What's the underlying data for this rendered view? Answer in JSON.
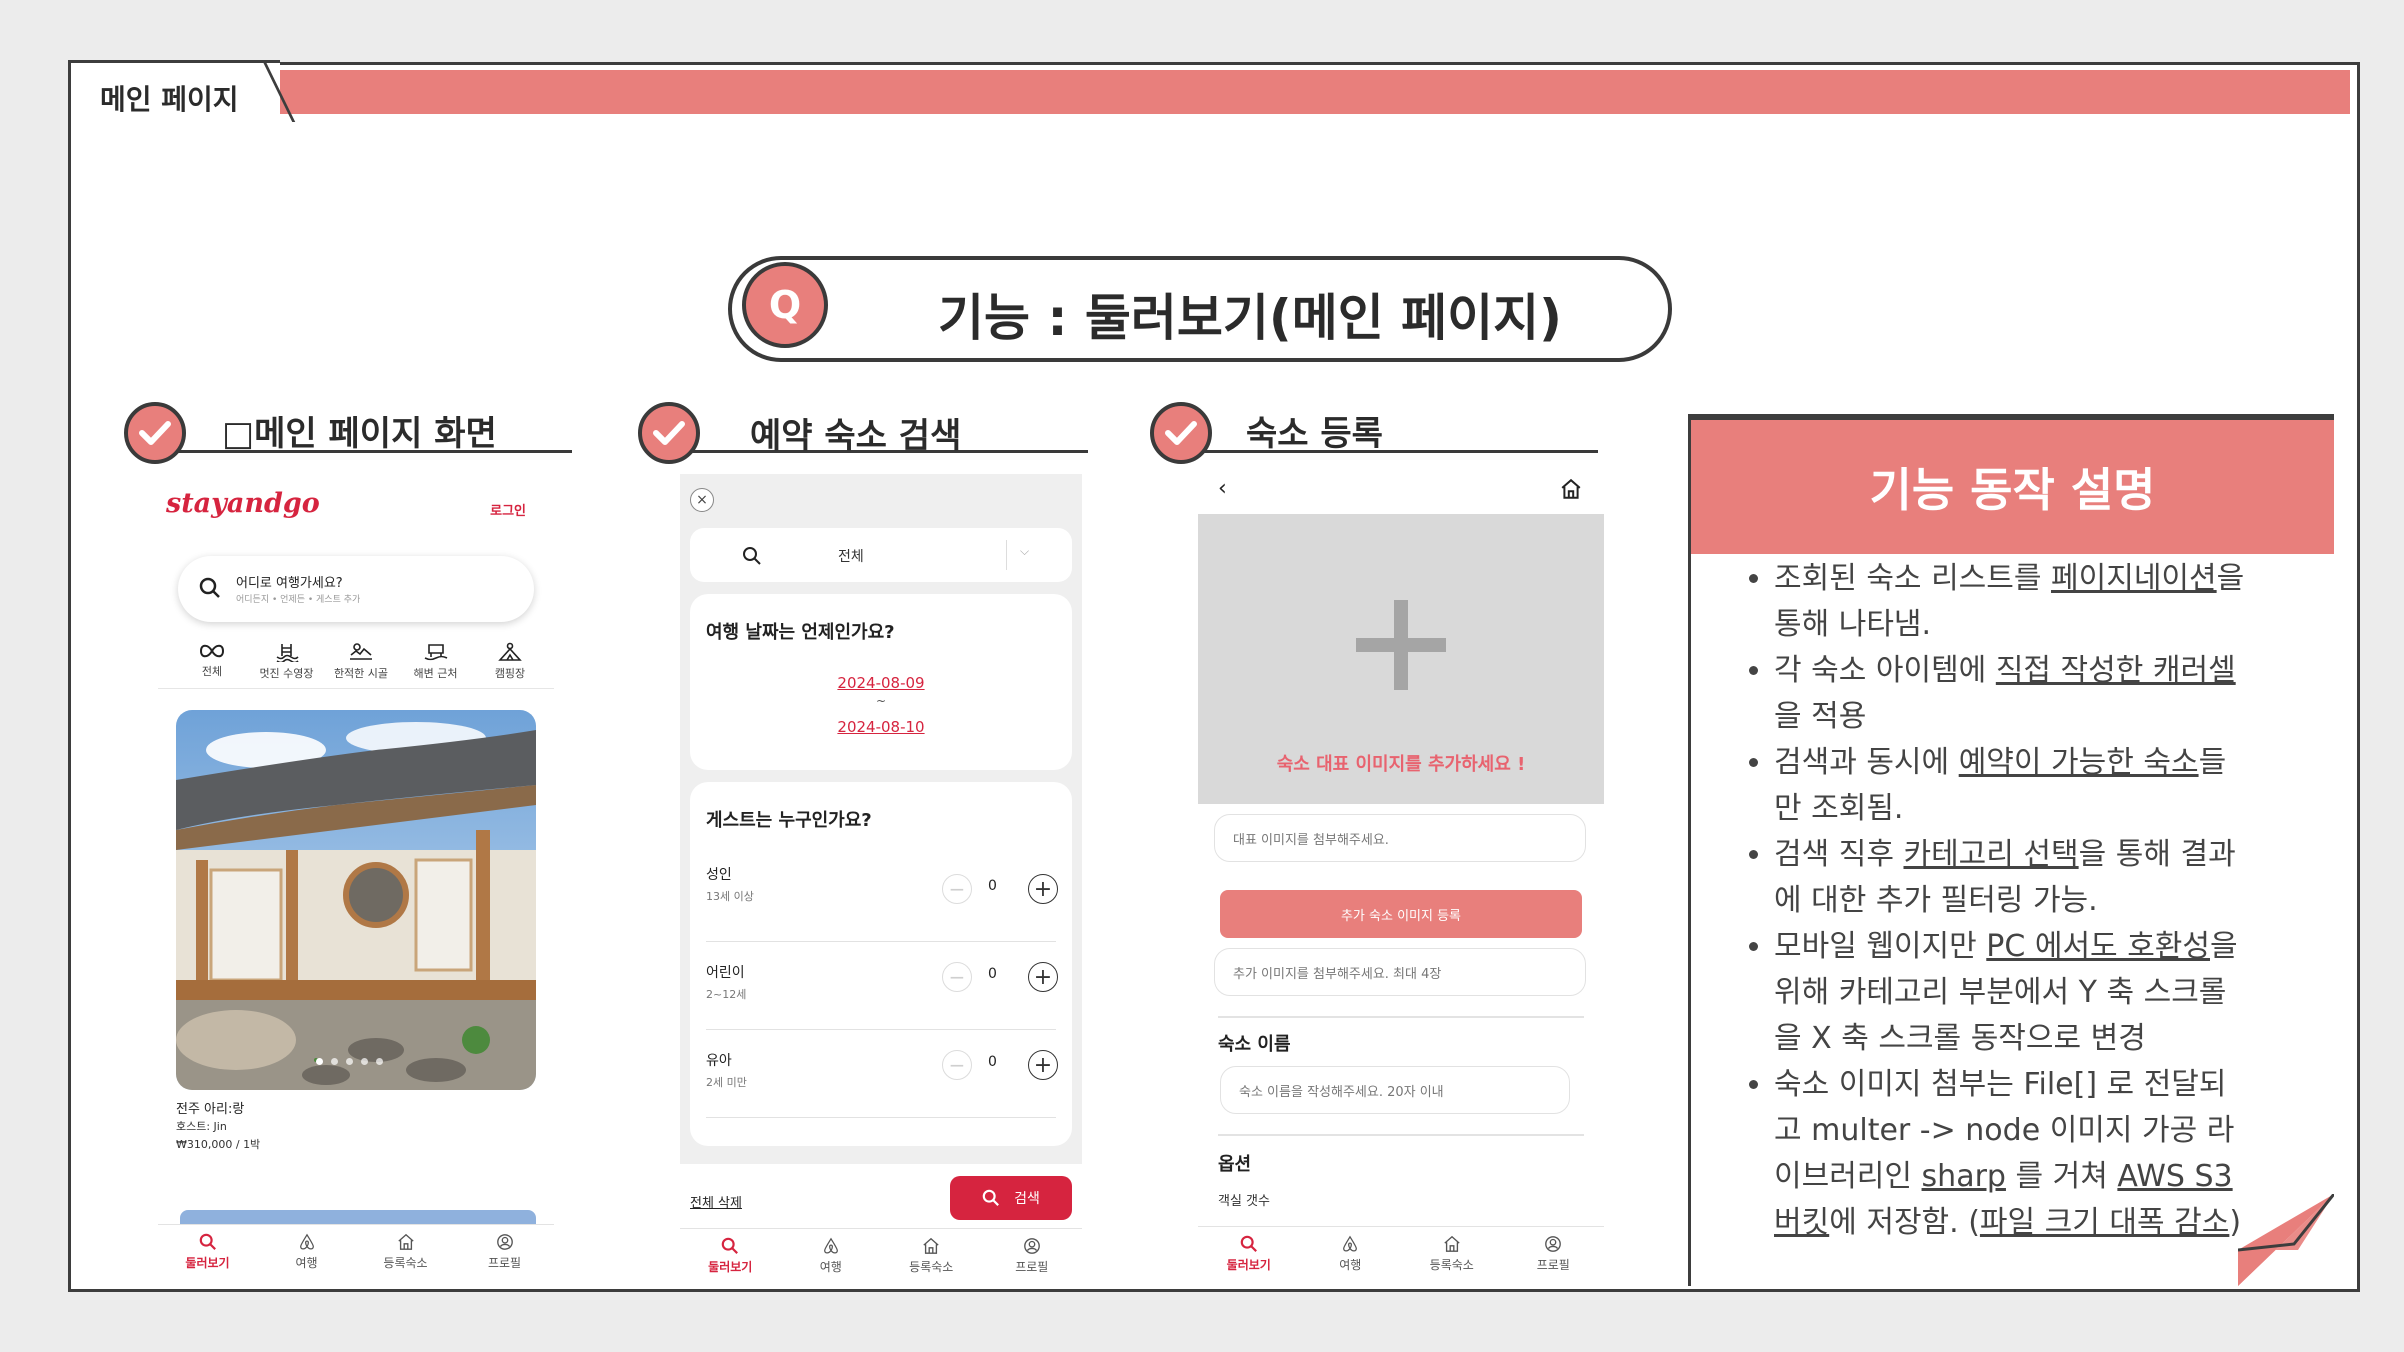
{
  "slide": {
    "tab_label": "메인 페이지",
    "title_badge": "Q",
    "title": "기능 : 둘러보기(메인 페이지)",
    "colors": {
      "accent": "#e87f7c",
      "frame": "#3d3d3d",
      "brand_red": "#d6243f"
    }
  },
  "sections": [
    {
      "label": "□메인 페이지 화면"
    },
    {
      "label": "예약 숙소 검색"
    },
    {
      "label": "숙소 등록"
    }
  ],
  "phone1": {
    "logo": "stayandgo",
    "login": "로그인",
    "search_title": "어디로 여행가세요?",
    "search_sub": "어디든지 • 언제든 • 게스트 추가",
    "categories": [
      {
        "label": "전체",
        "icon": "infinity-icon"
      },
      {
        "label": "멋진 수영장",
        "icon": "pool-icon"
      },
      {
        "label": "한적한 시골",
        "icon": "countryside-icon"
      },
      {
        "label": "해변 근처",
        "icon": "beach-icon"
      },
      {
        "label": "캠핑장",
        "icon": "camping-icon"
      }
    ],
    "listing": {
      "title": "전주 아리:랑",
      "host": "호스트: Jin",
      "price": "₩310,000 / 1박"
    }
  },
  "phone2": {
    "search_value": "전체",
    "date_question": "여행 날짜는 언제인가요?",
    "date_start": "2024-08-09",
    "date_sep": "~",
    "date_end": "2024-08-10",
    "guest_question": "게스트는 누구인가요?",
    "guests": [
      {
        "label": "성인",
        "sub": "13세 이상",
        "count": "0"
      },
      {
        "label": "어린이",
        "sub": "2~12세",
        "count": "0"
      },
      {
        "label": "유아",
        "sub": "2세 미만",
        "count": "0"
      }
    ],
    "clear_all": "전체 삭제",
    "search_button": "검색"
  },
  "phone3": {
    "add_image_text": "숙소 대표 이미지를 추가하세요 !",
    "main_image_placeholder": "대표 이미지를 첨부해주세요.",
    "add_images_button": "추가 숙소 이미지 등록",
    "extra_images_placeholder": "추가 이미지를 첨부해주세요. 최대 4장",
    "name_label": "숙소 이름",
    "name_placeholder": "숙소 이름을 작성해주세요. 20자 이내",
    "options_label": "옵션",
    "room_count_label": "객실 갯수"
  },
  "bottom_nav": [
    {
      "label": "둘러보기",
      "icon": "search-icon"
    },
    {
      "label": "여행",
      "icon": "airbnb-icon"
    },
    {
      "label": "등록숙소",
      "icon": "house-icon"
    },
    {
      "label": "프로필",
      "icon": "profile-icon"
    }
  ],
  "panel": {
    "title": "기능 동작 설명",
    "items": [
      {
        "pre": "조회된 숙소 리스트를 ",
        "u": "페이지네이션",
        "post": "을 통해 나타냄."
      },
      {
        "pre": "각 숙소 아이템에 ",
        "u": "직접 작성한 캐러셀",
        "post": "을 적용"
      },
      {
        "pre": "검색과 동시에 ",
        "u": "예약이 가능한 숙소",
        "post": "들만 조회됨."
      },
      {
        "pre": "검색 직후 ",
        "u": "카테고리 선택",
        "post": "을 통해 결과에 대한 추가 필터링 가능."
      },
      {
        "pre": "모바일 웹이지만 ",
        "u": "PC 에서도 호환성",
        "post": "을 위해 카테고리 부분에서 Y 축 스크롤을 X 축 스크롤 동작으로 변경"
      },
      {
        "pre": "숙소 이미지 첨부는 File[] 로 전달되고 multer -> node 이미지 가공 라이브러리인 ",
        "u": "sharp",
        "mid": " 를 거쳐 ",
        "u2": "AWS S3 버킷",
        "post": "에 저장함. (",
        "u3": "파일 크기 대폭 감소",
        "end": ")"
      }
    ]
  }
}
